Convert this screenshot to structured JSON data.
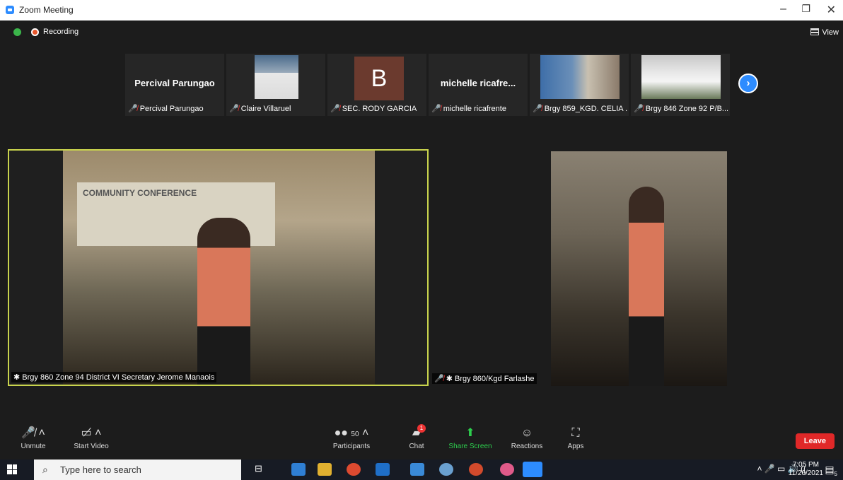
{
  "window": {
    "title": "Zoom Meeting"
  },
  "status": {
    "recording": "Recording",
    "view": "View"
  },
  "thumbnails": [
    {
      "display": "Percival Parungao",
      "name": "Percival Parungao",
      "type": "text"
    },
    {
      "display": "",
      "name": "Claire Villaruel",
      "type": "photo"
    },
    {
      "display": "B",
      "name": "SEC. RODY GARCIA",
      "type": "avatar"
    },
    {
      "display": "michelle  ricafre...",
      "name": "michelle ricafrente",
      "type": "text"
    },
    {
      "display": "",
      "name": "Brgy 859_KGD. CELIA ...",
      "type": "photo"
    },
    {
      "display": "",
      "name": "Brgy 846 Zone 92 P/B...",
      "type": "photo"
    }
  ],
  "videos": {
    "active_speaker": "Brgy 860 Zone 94 District VI Secretary Jerome Manaois",
    "banner_text": "COMMUNITY CONFERENCE",
    "second": "Brgy 860/Kgd Farlashe"
  },
  "controls": {
    "unmute": "Unmute",
    "start_video": "Start Video",
    "participants": "Participants",
    "participants_count": "50",
    "chat": "Chat",
    "chat_badge": "1",
    "share_screen": "Share Screen",
    "reactions": "Reactions",
    "apps": "Apps",
    "leave": "Leave"
  },
  "taskbar": {
    "search_placeholder": "Type here to search",
    "time": "7:05 PM",
    "date": "11/26/2021",
    "notifications": "5"
  },
  "colors": {
    "zoom_blue": "#2d8cff",
    "leave_red": "#e02828",
    "share_green": "#2dce4d",
    "speaker_border": "#c9d44d"
  }
}
